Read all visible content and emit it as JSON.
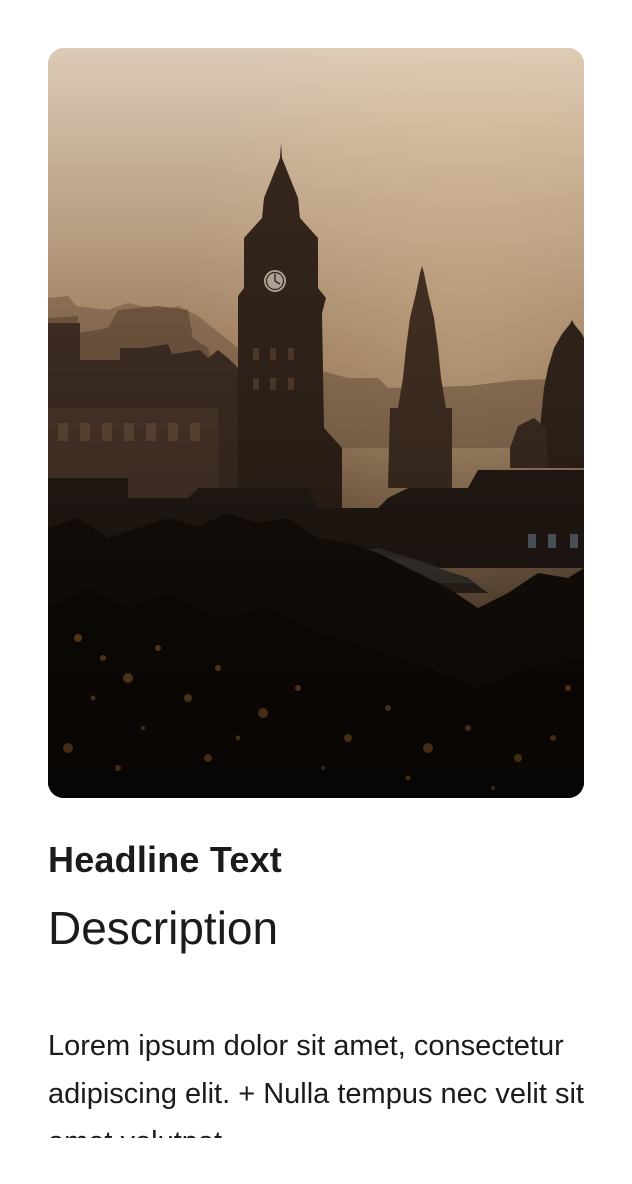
{
  "card": {
    "image_alt": "City skyline at sunset with clock tower and spires",
    "headline": "Headline Text",
    "description": "Description",
    "body": "Lorem ipsum dolor sit amet, consectetur adipiscing elit. + Nulla tempus nec velit sit amet volutpat."
  }
}
